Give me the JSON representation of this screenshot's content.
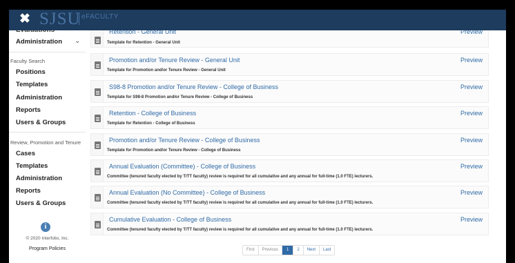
{
  "header": {
    "close_label": "✖",
    "brand": "SJSU",
    "product": "eFACULTY"
  },
  "sidebar": {
    "cut_item": "Evaluations",
    "administration": "Administration",
    "faculty_search": {
      "heading": "Faculty Search",
      "items": [
        "Positions",
        "Templates",
        "Administration",
        "Reports",
        "Users & Groups"
      ]
    },
    "rpt": {
      "heading": "Review, Promotion and Tenure",
      "items": [
        "Cases",
        "Templates",
        "Administration",
        "Reports",
        "Users & Groups"
      ]
    },
    "copyright": "© 2020 Interfolio, Inc.",
    "policies": "Program Policies"
  },
  "templates": [
    {
      "title": "Retention - General Unit",
      "description": "Template for Retention - General Unit",
      "action": "Preview"
    },
    {
      "title": "Promotion and/or Tenure Review - General Unit",
      "description": "Template for Promotion and/or Tenure Review - General Unit",
      "action": "Preview"
    },
    {
      "title": "S98-8 Promotion and/or Tenure Review - College of Business",
      "description": "Template for S98-8 Promotion and/or Tenure Review - College of Business",
      "action": "Preview"
    },
    {
      "title": "Retention - College of Business",
      "description": "Template for Retention - College of Business",
      "action": "Preview"
    },
    {
      "title": "Promotion and/or Tenure Review - College of Business",
      "description": "Template for Promotion and/or Tenure Review - College of Business",
      "action": "Preview"
    },
    {
      "title": "Annual Evaluation (Committee) - College of Business",
      "description": "Committee (tenured faculty elected by T/TT faculty) review is required for all cumulative and any annual for full-time (1.0 FTE) lecturers.",
      "action": "Preview"
    },
    {
      "title": "Annual Evaluation (No Committee) - College of Business",
      "description": "Committee (tenured faculty elected by T/TT faculty) review is required for all cumulative and any annual for full-time (1.0 FTE) lecturers.",
      "action": "Preview"
    },
    {
      "title": "Cumulative Evaluation - College of Business",
      "description": "Committee (tenured faculty elected by T/TT faculty) review is required for all cumulative and any annual for full-time (1.0 FTE) lecturers.",
      "action": "Preview"
    }
  ],
  "pagination": {
    "first": "First",
    "previous": "Previous",
    "pages": [
      "1",
      "2"
    ],
    "current": "1",
    "next": "Next",
    "last": "Last"
  }
}
